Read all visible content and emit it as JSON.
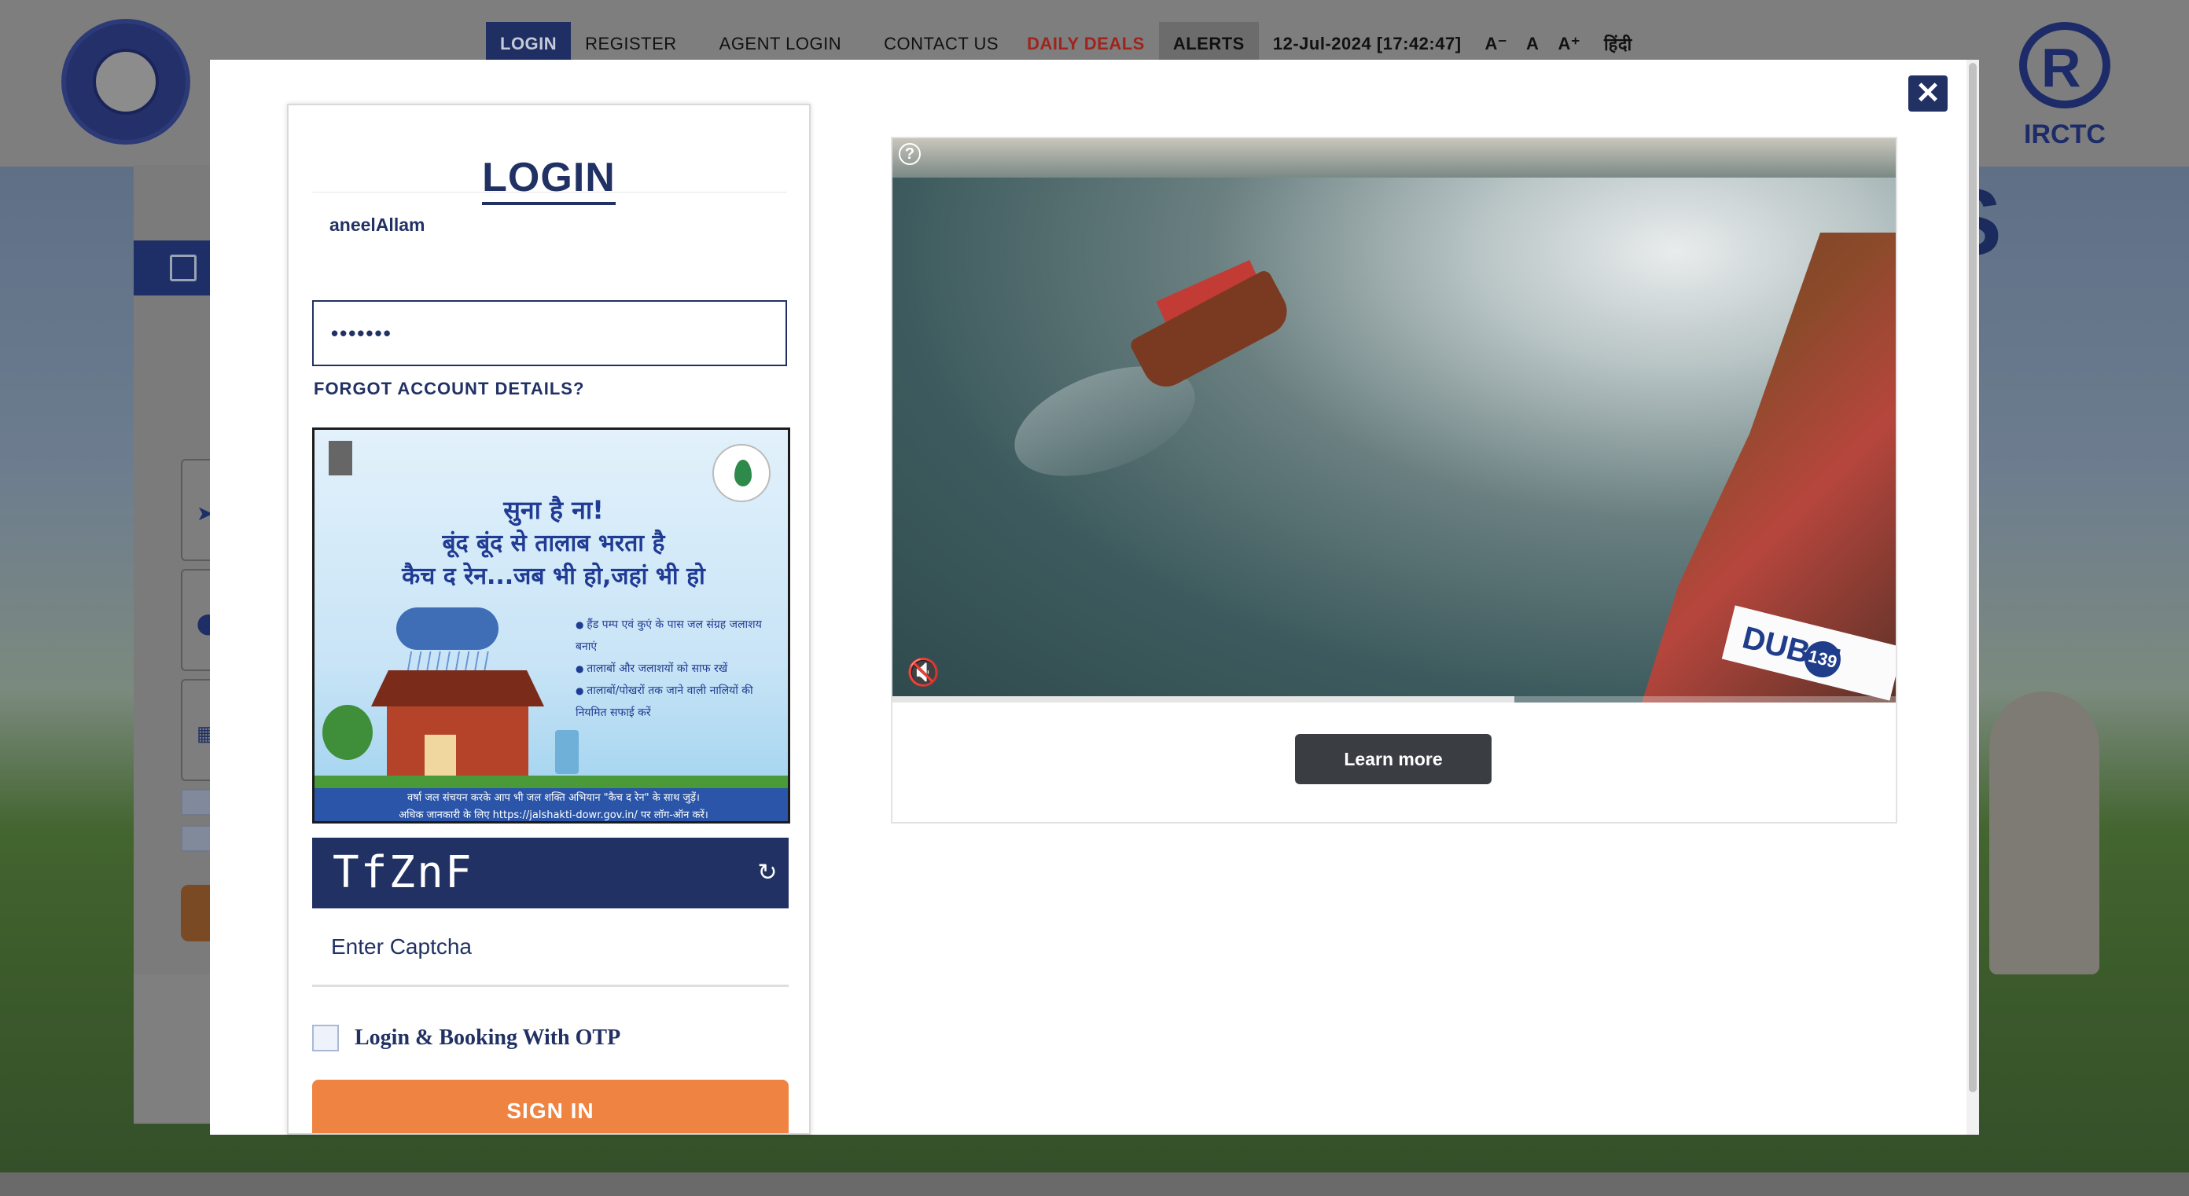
{
  "nav": {
    "login": "LOGIN",
    "register": "REGISTER",
    "agent_login": "AGENT LOGIN",
    "contact_us": "CONTACT US",
    "daily_deals": "DAILY DEALS",
    "alerts": "ALERTS",
    "datetime": "12-Jul-2024 [17:42:47]",
    "font_decrease": "A⁻",
    "font_normal": "A",
    "font_increase": "A⁺",
    "language": "हिंदी"
  },
  "logos": {
    "irctc": "IRCTC"
  },
  "background": {
    "partial_heading": "S"
  },
  "login_modal": {
    "title": "LOGIN",
    "username_value": "aneelAllam",
    "password_value": "•••••••",
    "forgot_link": "FORGOT ACCOUNT DETAILS?",
    "banner": {
      "headline_1": "सुना है ना!",
      "headline_2": "बूंद बूंद से तालाब भरता है",
      "headline_3": "कैच द रेन...जब भी हो,जहां भी हो",
      "bullets": [
        "हैंड पम्प एवं कुएं के पास जल संग्रह जलाशय बनाएं",
        "तालाबों और जलाशयों को साफ रखें",
        "तालाबों/पोखरों तक जाने वाली नालियों की नियमित सफाई करें"
      ],
      "footer_line_1": "वर्षा जल संचयन करके आप भी जल शक्ति अभियान \"कैच द रेन\" के साथ जुड़ें।",
      "footer_line_2": "अधिक जानकारी के लिए https://jalshakti-dowr.gov.in/ पर लॉग-ऑन करें।"
    },
    "captcha_text": "TfZnF",
    "captcha_placeholder": "Enter Captcha",
    "otp_label": "Login & Booking With OTP",
    "otp_checked": false,
    "sign_in_label": "SIGN IN"
  },
  "ad": {
    "boat_sign_text": "DUBAI",
    "boat_number": "139",
    "video_progress": 0.62,
    "learn_more_label": "Learn more"
  },
  "colors": {
    "navy": "#213163",
    "orange": "#ef8341",
    "deals_red": "#a0241c"
  }
}
